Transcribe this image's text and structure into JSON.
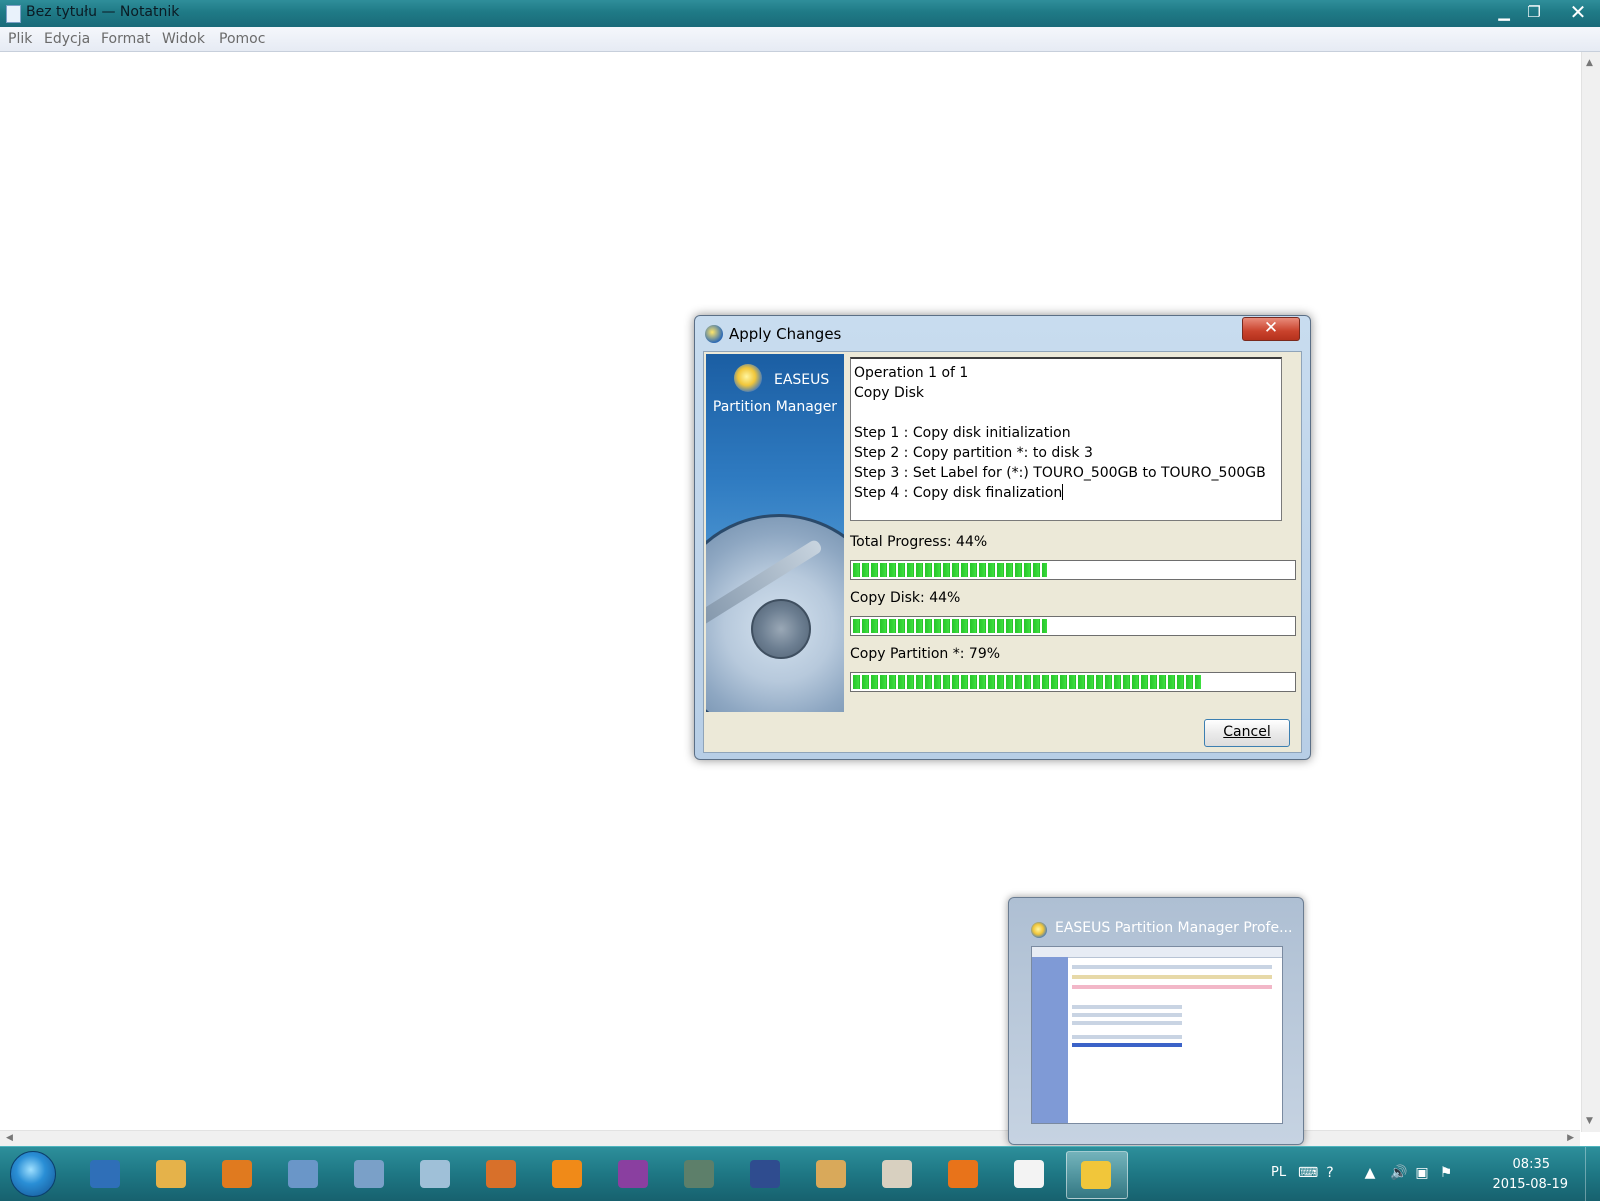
{
  "notepad": {
    "title": "Bez tytułu — Notatnik",
    "menu": [
      "Plik",
      "Edycja",
      "Format",
      "Widok",
      "Pomoc"
    ],
    "controls": {
      "minimize": "▁",
      "maximize": "❐",
      "close": "✕"
    }
  },
  "dialog": {
    "title": "Apply Changes",
    "close_label": "✕",
    "brand_line1": "EASEUS",
    "brand_line2": "Partition Manager",
    "operations": [
      "Operation 1 of 1",
      "Copy Disk",
      "",
      "Step 1 : Copy disk initialization",
      "Step 2 : Copy partition *: to disk 3",
      "Step 3 : Set Label for (*:) TOURO_500GB to TOURO_500GB",
      "Step 4 : Copy disk finalization"
    ],
    "progress": [
      {
        "label": "Total Progress: 44%",
        "value": 44
      },
      {
        "label": "Copy Disk: 44%",
        "value": 44
      },
      {
        "label": "Copy Partition *: 79%",
        "value": 79
      }
    ],
    "cancel_label": "Cancel"
  },
  "preview": {
    "title": "EASEUS Partition Manager Profe..."
  },
  "taskbar": {
    "items": [
      "internet-explorer-icon",
      "file-explorer-icon",
      "media-player-icon",
      "remote-desktop-icon",
      "calculator-icon",
      "notepad-icon",
      "winrar-icon-books",
      "vlc-icon",
      "winrar-icon",
      "system-monitor-icon",
      "save-disk-icon",
      "image-viewer-icon",
      "paint-icon",
      "firefox-icon",
      "calendar-icon",
      "easeus-icon"
    ],
    "colors": [
      "#2f6fb8",
      "#e5b24a",
      "#e07a1f",
      "#6a96c8",
      "#7aa0c8",
      "#9fc0d8",
      "#d8702a",
      "#f08a18",
      "#8a3fa0",
      "#5d7f6a",
      "#2f4c8f",
      "#d9a95a",
      "#d8d0c0",
      "#e8731a",
      "#f3f3f3",
      "#f1c63a"
    ],
    "active_index": 15,
    "tray": {
      "lang": "PL",
      "time": "08:35",
      "date": "2015-08-19"
    }
  }
}
